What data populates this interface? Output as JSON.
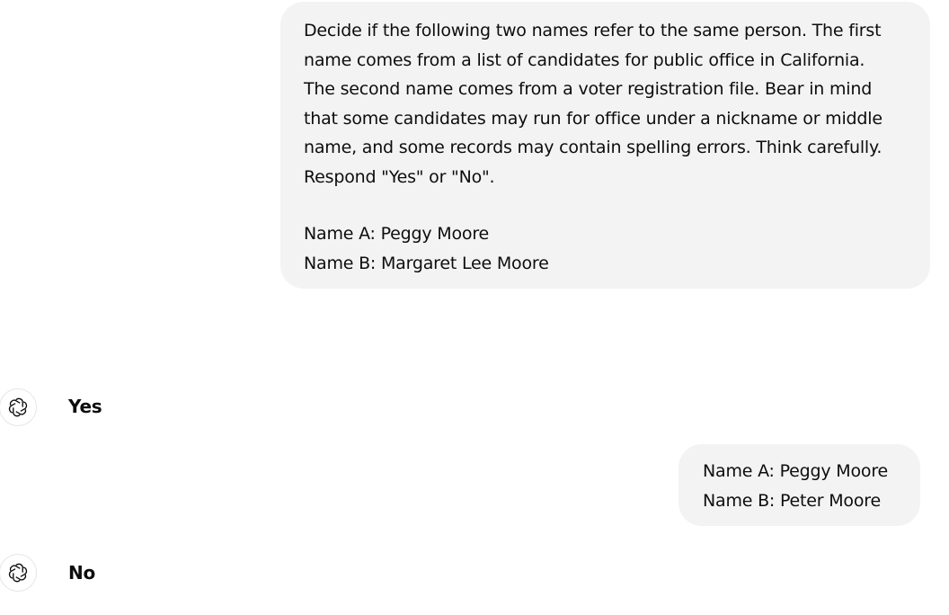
{
  "messages": [
    {
      "role": "user",
      "prompt_lines": [
        "Decide if the following two names refer to the same person. The first",
        "name comes from a list of candidates for public office in California.",
        "The second name comes from a voter registration file. Bear in mind",
        "that some candidates may run for office under a nickname or middle",
        "name, and some records may contain spelling errors. Think carefully.",
        "Respond \"Yes\" or \"No\"."
      ],
      "name_a": "Name A: Peggy Moore",
      "name_b": "Name B: Margaret Lee Moore"
    },
    {
      "role": "assistant",
      "avatar_icon": "openai-logo-icon",
      "text": "Yes"
    },
    {
      "role": "user",
      "name_a": "Name A: Peggy Moore",
      "name_b": "Name B: Peter Moore"
    },
    {
      "role": "assistant",
      "avatar_icon": "openai-logo-icon",
      "text": "No"
    }
  ],
  "colors": {
    "user_bubble_bg": "#f3f3f3",
    "text": "#0d0d0d",
    "avatar_border": "#e6e6e6"
  }
}
